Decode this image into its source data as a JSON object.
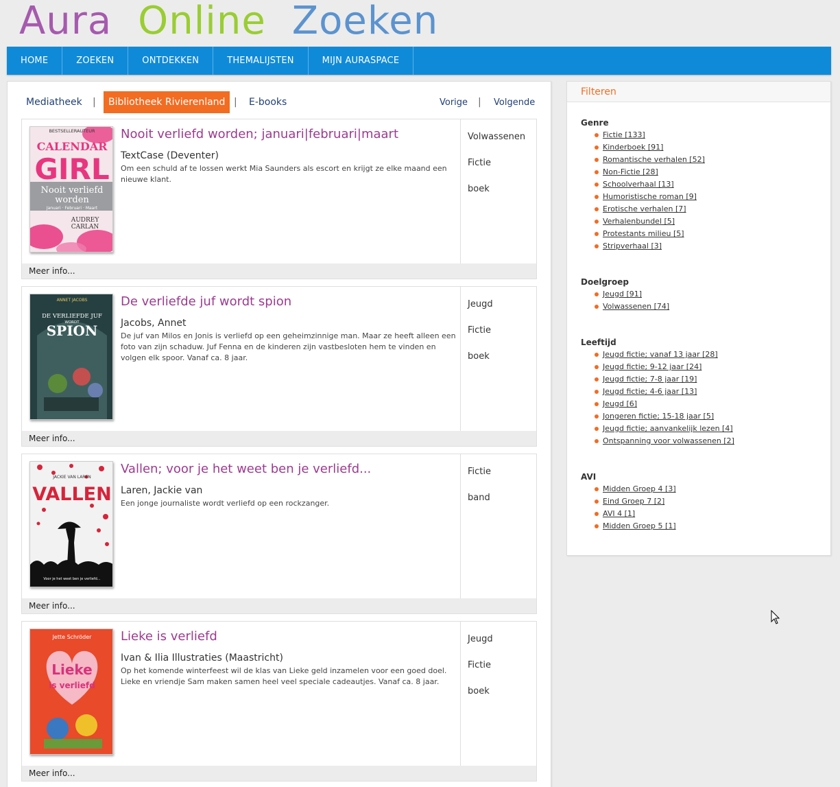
{
  "logo": {
    "word1": "Aura",
    "word2": "Online",
    "word3": "Zoeken"
  },
  "nav": [
    "HOME",
    "ZOEKEN",
    "ONTDEKKEN",
    "THEMALIJSTEN",
    "MIJN AURASPACE"
  ],
  "tabs": {
    "mediatheek": "Mediatheek",
    "bibliotheek": "Bibliotheek Rivierenland",
    "ebooks": "E-books",
    "separator": "|"
  },
  "pager": {
    "prev": "Vorige",
    "next": "Volgende",
    "separator": "|"
  },
  "results": [
    {
      "title": "Nooit verliefd worden; januari|februari|maart",
      "author": "TextCase (Deventer)",
      "description": "Om een schuld af te lossen werkt Mia Saunders als escort en krijgt ze elke maand een nieuwe klant.",
      "meta": [
        "Volwassenen",
        "Fictie",
        "boek"
      ],
      "more": "Meer info...",
      "cover": {
        "top": "BESTSELLERAUTEUR",
        "line1": "CALENDAR",
        "line2": "GIRL",
        "line3": "Nooit verliefd",
        "line4": "worden",
        "line5": "Januari · Februari · Maart",
        "line6": "AUDREY",
        "line7": "CARLAN"
      }
    },
    {
      "title": "De verliefde juf wordt spion",
      "author": "Jacobs, Annet",
      "description": "De juf van Milos en Jonis is verliefd op een geheimzinnige man. Maar ze heeft alleen een foto van zijn schaduw. Juf Fenna en de kinderen zijn vastbesloten hem te vinden en volgen elk spoor. Vanaf ca. 8 jaar.",
      "meta": [
        "Jeugd",
        "Fictie",
        "boek"
      ],
      "more": "Meer info...",
      "cover": {
        "top": "ANNET JACOBS",
        "line1": "DE VERLIEFDE JUF",
        "line2": "WORDT",
        "line3": "SPION"
      }
    },
    {
      "title": "Vallen; voor je het weet ben je verliefd...",
      "author": "Laren, Jackie van",
      "description": "Een jonge journaliste wordt verliefd op een rockzanger.",
      "meta": [
        "Fictie",
        "band"
      ],
      "more": "Meer info...",
      "cover": {
        "top": "JACKIE VAN LAREN",
        "line1": "VALLEN",
        "line2": "Voor je het weet ben je verliefd..."
      }
    },
    {
      "title": "Lieke is verliefd",
      "author": "Ivan & Ilia Illustraties (Maastricht)",
      "description": "Op het komende winterfeest wil de klas van Lieke geld inzamelen voor een goed doel. Lieke en vriendje Sam maken samen heel veel speciale cadeautjes. Vanaf ca. 8 jaar.",
      "meta": [
        "Jeugd",
        "Fictie",
        "boek"
      ],
      "more": "Meer info...",
      "cover": {
        "top": "Jette Schröder",
        "line1": "Lieke",
        "line2": "is verliefd"
      }
    }
  ],
  "filter": {
    "heading": "Filteren",
    "groups": [
      {
        "name": "Genre",
        "items": [
          "Fictie [133]",
          "Kinderboek [91]",
          "Romantische verhalen [52]",
          "Non-Fictie [28]",
          "Schoolverhaal [13]",
          "Humoristische roman [9]",
          "Erotische verhalen [7]",
          "Verhalenbundel [5]",
          "Protestants milieu [5]",
          "Stripverhaal [3]"
        ]
      },
      {
        "name": "Doelgroep",
        "items": [
          "Jeugd [91]",
          "Volwassenen [74]"
        ]
      },
      {
        "name": "Leeftijd",
        "items": [
          "Jeugd fictie; vanaf 13 jaar [28]",
          "Jeugd fictie; 9-12 jaar [24]",
          "Jeugd fictie; 7-8 jaar [19]",
          "Jeugd fictie; 4-6 jaar [13]",
          "Jeugd [6]",
          "Jongeren fictie; 15-18 jaar [5]",
          "Jeugd fictie; aanvankelijk lezen [4]",
          "Ontspanning voor volwassenen [2]"
        ]
      },
      {
        "name": "AVI",
        "items": [
          "Midden Groep 4 [3]",
          "Eind Groep 7 [2]",
          "AVI 4 [1]",
          "Midden Groep 5 [1]"
        ]
      }
    ]
  },
  "colors": {
    "nav": "#0f8ad8",
    "accent": "#f26c22",
    "title": "#9c3a8f",
    "link": "#1f3f76"
  }
}
